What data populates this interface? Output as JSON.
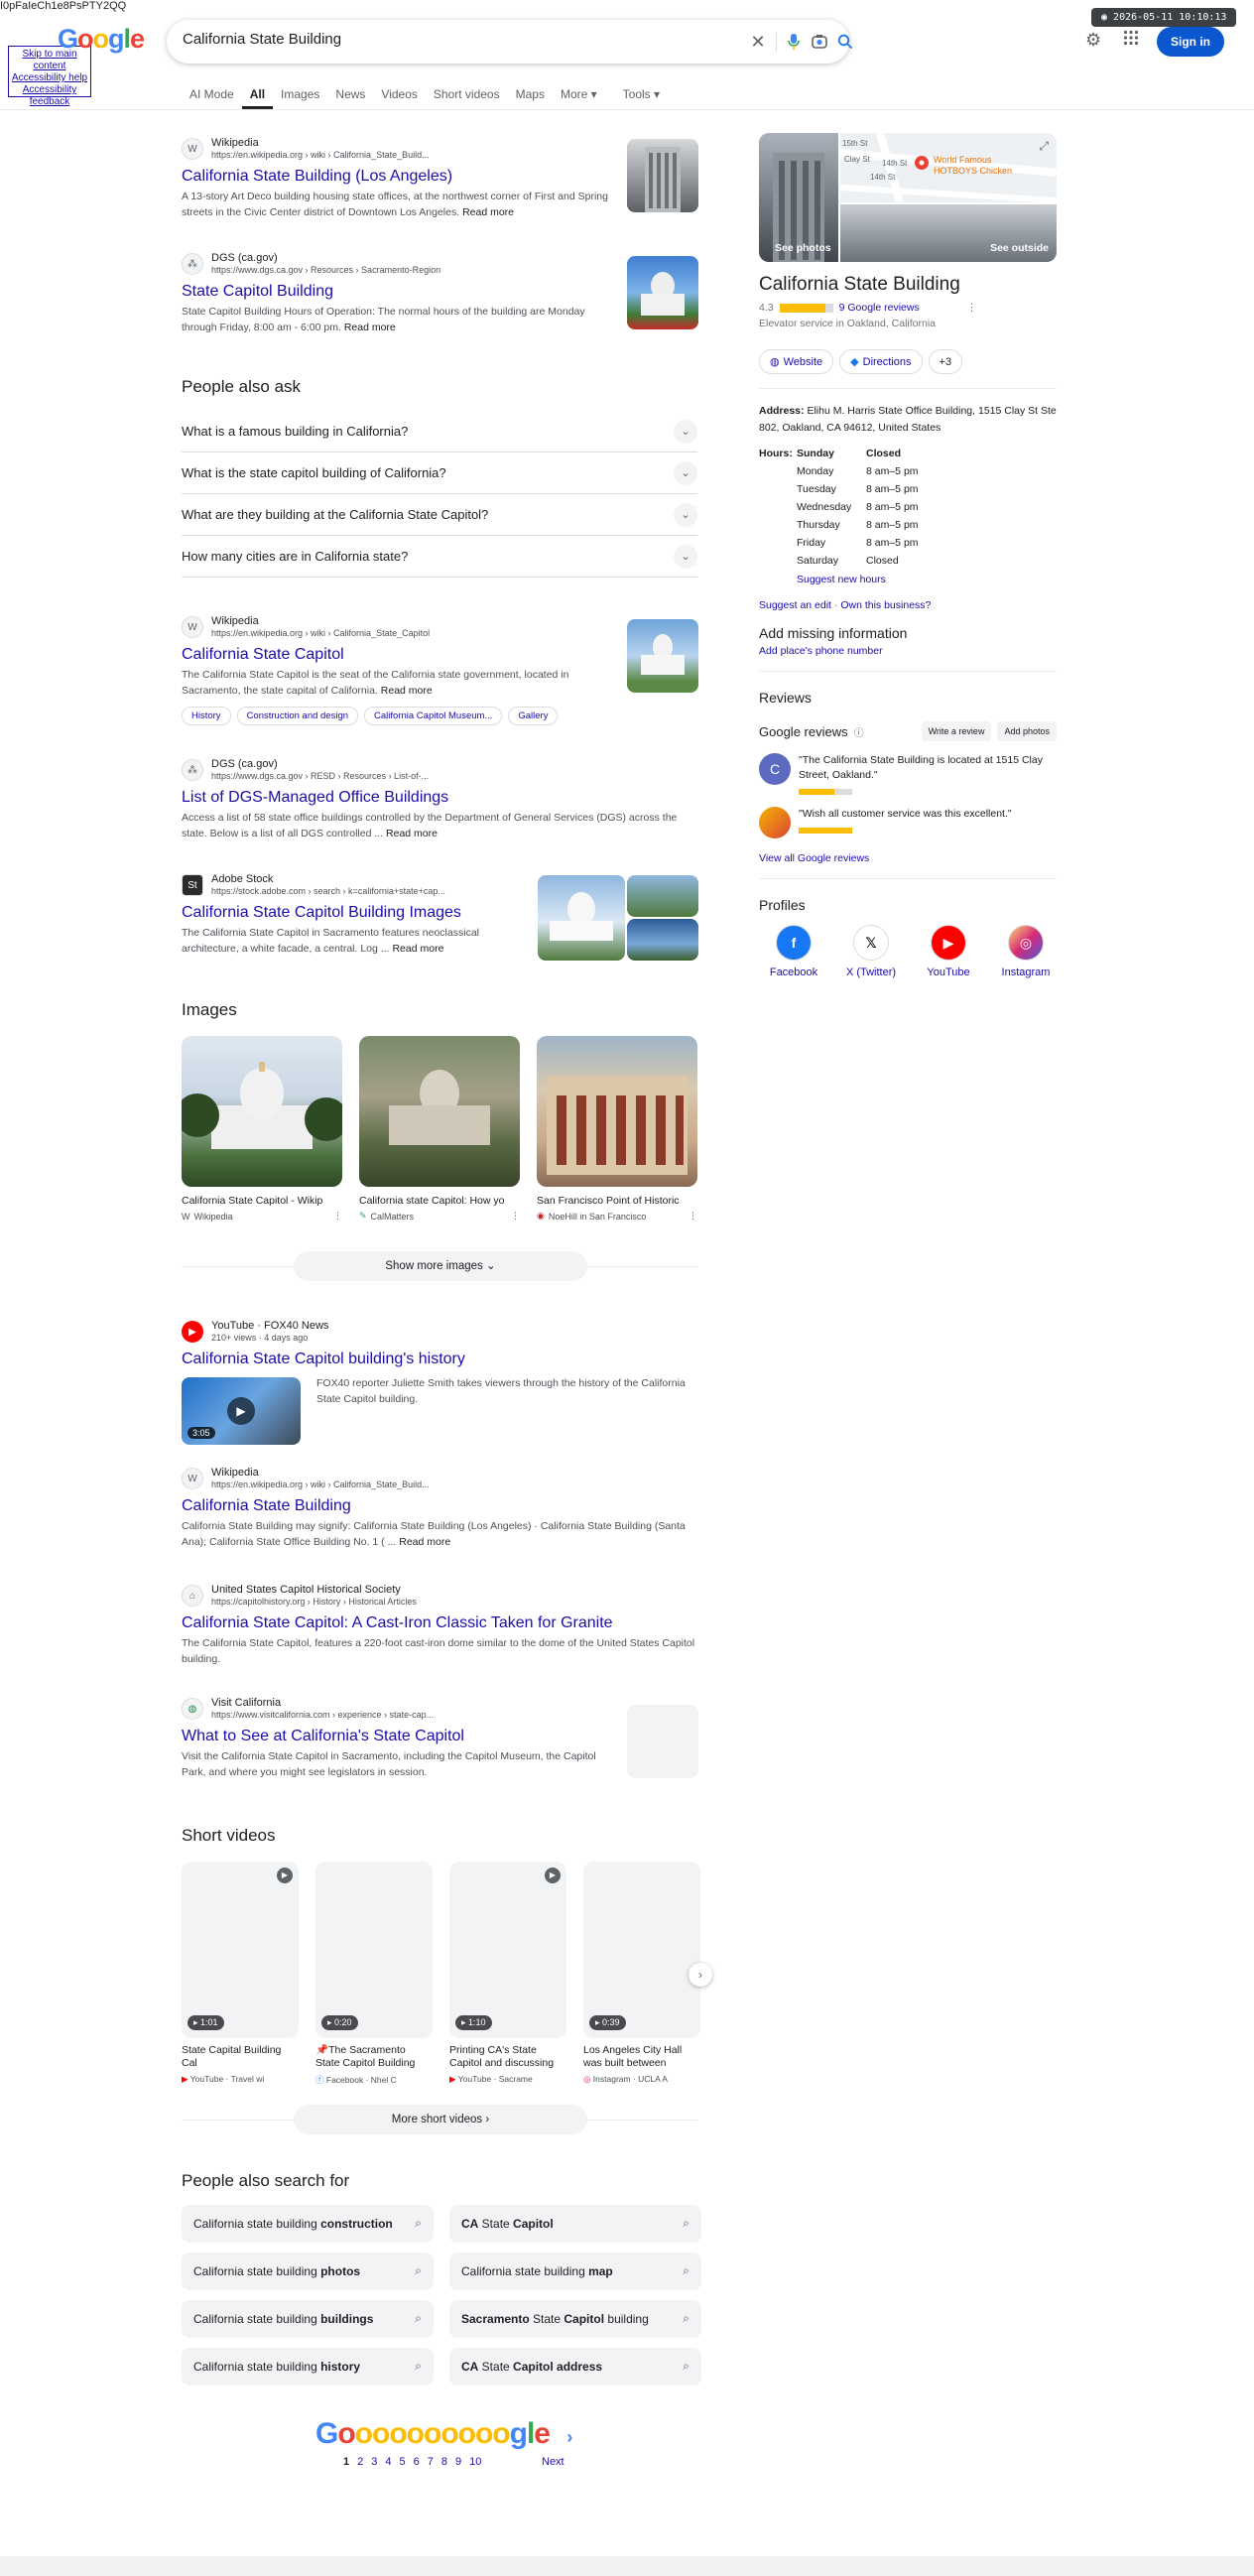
{
  "top_id": "I0pFaIeCh1e8PsPTY2QQ",
  "skip_links": [
    "Skip to main content",
    "Accessibility help",
    "Accessibility feedback"
  ],
  "logo": {
    "letters": [
      "G",
      "o",
      "o",
      "g",
      "l",
      "e"
    ],
    "colors": [
      "#4285f4",
      "#ea4335",
      "#fbbc05",
      "#4285f4",
      "#34a853",
      "#ea4335"
    ]
  },
  "search": {
    "query": "California State Building"
  },
  "timestamp": "2026-05-11 10:10:13",
  "signin_label": "Sign in",
  "tabs": [
    "AI Mode",
    "All",
    "Images",
    "News",
    "Videos",
    "Short videos",
    "Maps",
    "More",
    "Tools"
  ],
  "results": [
    {
      "source": "Wikipedia",
      "url": "https://en.wikipedia.org › wiki › California_State_Build...",
      "title": "California State Building (Los Angeles)",
      "snippet": "A 13-story Art Deco building housing state offices, at the northwest corner of First and Spring streets in the Civic Center district of Downtown Los Angeles.",
      "more": "Read more"
    },
    {
      "source": "DGS (ca.gov)",
      "url": "https://www.dgs.ca.gov › Resources › Sacramento-Region",
      "title": "State Capitol Building",
      "snippet": "State Capitol Building Hours of Operation: The normal hours of the building are Monday through Friday, 8:00 am - 6:00 pm.",
      "more": "Read more"
    }
  ],
  "paa": {
    "title": "People also ask",
    "questions": [
      "What is a famous building in California?",
      "What is the state capitol building of California?",
      "What are they building at the California State Capitol?",
      "How many cities are in California state?"
    ]
  },
  "results2": [
    {
      "source": "Wikipedia",
      "url": "https://en.wikipedia.org › wiki › California_State_Capitol",
      "title": "California State Capitol",
      "snippet": "The California State Capitol is the seat of the California state government, located in Sacramento, the state capital of California.",
      "more": "Read more",
      "chips": [
        "History",
        "Construction and design",
        "California Capitol Museum...",
        "Gallery"
      ]
    },
    {
      "source": "DGS (ca.gov)",
      "url": "https://www.dgs.ca.gov › RESD › Resources › List-of-...",
      "title": "List of DGS-Managed Office Buildings",
      "snippet": "Access a list of 58 state office buildings controlled by the Department of General Services (DGS) across the state. Below is a list of all DGS controlled ...",
      "more": "Read more"
    },
    {
      "source": "Adobe Stock",
      "url": "https://stock.adobe.com › search › k=california+state+cap...",
      "title": "California State Capitol Building Images",
      "snippet": "The California State Capitol in Sacramento features neoclassical architecture, a white facade, a central. Log ...",
      "more": "Read more"
    }
  ],
  "images": {
    "title": "Images",
    "items": [
      {
        "caption": "California State Capitol - Wikip",
        "source": "Wikipedia"
      },
      {
        "caption": "California state Capitol: How yo",
        "source": "CalMatters"
      },
      {
        "caption": "San Francisco Point of Historic",
        "source": "NoeHill in San Francisco"
      }
    ],
    "more": "Show more images"
  },
  "video": {
    "source": "YouTube · FOX40 News",
    "meta": "210+ views · 4 days ago",
    "title": "California State Capitol building's history",
    "snippet": "FOX40 reporter Juliette Smith takes viewers through the history of the California State Capitol building.",
    "duration": "3:05"
  },
  "results3": [
    {
      "source": "Wikipedia",
      "url": "https://en.wikipedia.org › wiki › California_State_Build...",
      "title": "California State Building",
      "snippet": "California State Building may signify: California State Building (Los Angeles) · California State Building (Santa Ana); California State Office Building No. 1 ( ...",
      "more": "Read more"
    },
    {
      "source": "United States Capitol Historical Society",
      "url": "https://capitolhistory.org › History › Historical Articles",
      "title": "California State Capitol: A Cast-Iron Classic Taken for Granite",
      "snippet": "The California State Capitol, features a 220-foot cast-iron dome similar to the dome of the United States Capitol building."
    },
    {
      "source": "Visit California",
      "url": "https://www.visitcalifornia.com › experience › state-cap...",
      "title": "What to See at California's State Capitol",
      "snippet": "Visit the California State Capitol in Sacramento, including the Capitol Museum, the Capitol Park, and where you might see legislators in session."
    }
  ],
  "short_videos": {
    "title": "Short videos",
    "items": [
      {
        "duration": "1:01",
        "caption": "State Capital Building Cal",
        "source": "YouTube · Travel wi"
      },
      {
        "duration": "0:20",
        "caption": "📌The Sacramento State Capitol Building",
        "source": "Facebook · Nhel C"
      },
      {
        "duration": "1:10",
        "caption": "Printing CA's State Capitol and discussing",
        "source": "YouTube · Sacrame"
      },
      {
        "duration": "0:39",
        "caption": "Los Angeles City Hall was built between",
        "source": "Instagram · UCLA A"
      }
    ],
    "more": "More short videos"
  },
  "pas": {
    "title": "People also search for",
    "items": [
      {
        "pre": "California state building ",
        "bold": "construction"
      },
      {
        "pre": "",
        "bold": "CA",
        "post": " State ",
        "bold2": "Capitol"
      },
      {
        "pre": "California state building ",
        "bold": "photos"
      },
      {
        "pre": "California state building ",
        "bold": "map"
      },
      {
        "pre": "California state building ",
        "bold": "buildings"
      },
      {
        "pre": "",
        "bold": "Sacramento",
        "post": " State ",
        "bold2": "Capitol",
        "post2": " building"
      },
      {
        "pre": "California state building ",
        "bold": "history"
      },
      {
        "pre": "",
        "bold": "CA",
        "post": " State ",
        "bold2": "Capitol address"
      }
    ]
  },
  "pagination": {
    "pages": [
      "1",
      "2",
      "3",
      "4",
      "5",
      "6",
      "7",
      "8",
      "9",
      "10"
    ],
    "next": "Next"
  },
  "kp": {
    "see_photos": "See photos",
    "see_outside": "See outside",
    "map_label": "World Famous HOTBOYS Chicken",
    "map_streets": [
      "15th St",
      "14th St",
      "Clay St",
      "14th St"
    ],
    "title": "California State Building",
    "rating": "4.3",
    "rating_fraction": 0.86,
    "reviews_link": "9 Google reviews",
    "category": "Elevator service in Oakland, California",
    "buttons": [
      "Website",
      "Directions",
      "+3"
    ],
    "address_label": "Address:",
    "address": "Elihu M. Harris State Office Building, 1515 Clay St Ste 802, Oakland, CA 94612, United States",
    "hours_label": "Hours:",
    "hours": [
      {
        "day": "Sunday",
        "time": "Closed"
      },
      {
        "day": "Monday",
        "time": "8 am–5 pm"
      },
      {
        "day": "Tuesday",
        "time": "8 am–5 pm"
      },
      {
        "day": "Wednesday",
        "time": "8 am–5 pm"
      },
      {
        "day": "Thursday",
        "time": "8 am–5 pm"
      },
      {
        "day": "Friday",
        "time": "8 am–5 pm"
      },
      {
        "day": "Saturday",
        "time": "Closed"
      }
    ],
    "suggest_hours": "Suggest new hours",
    "suggest_edit": "Suggest an edit",
    "own_business": "Own this business?",
    "add_missing": "Add missing information",
    "add_phone": "Add place's phone number",
    "reviews_title": "Reviews",
    "google_reviews": "Google reviews",
    "write_review": "Write a review",
    "add_photos": "Add photos",
    "review1": "\"The California State Building is located at 1515 Clay Street, Oakland.\"",
    "review2": "\"Wish all customer service was this excellent.\"",
    "view_all": "View all Google reviews",
    "profiles_title": "Profiles",
    "profiles": [
      "Facebook",
      "X (Twitter)",
      "YouTube",
      "Instagram"
    ]
  }
}
